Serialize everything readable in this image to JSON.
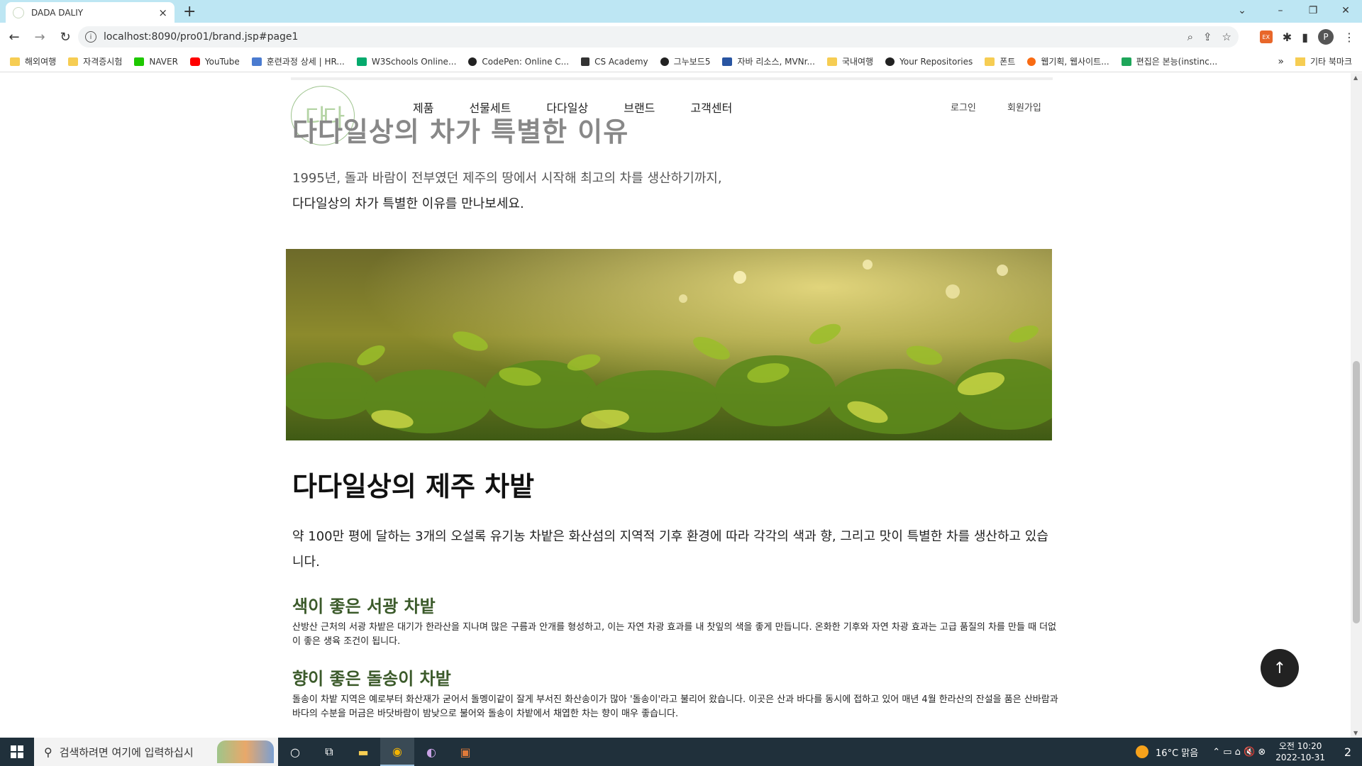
{
  "browser": {
    "tab_title": "DADA DALIY",
    "tab_close": "×",
    "new_tab": "+",
    "url": "localhost:8090/pro01/brand.jsp#page1",
    "window_controls": [
      "⌄",
      "–",
      "❐",
      "✕"
    ],
    "bookmarks": [
      {
        "label": "해외여행",
        "icon": "folder"
      },
      {
        "label": "자격증시험",
        "icon": "folder"
      },
      {
        "label": "NAVER",
        "icon": "naver"
      },
      {
        "label": "YouTube",
        "icon": "yt"
      },
      {
        "label": "훈련과정 상세 | HR...",
        "icon": "hrd"
      },
      {
        "label": "W3Schools Online...",
        "icon": "w3"
      },
      {
        "label": "CodePen: Online C...",
        "icon": "cp"
      },
      {
        "label": "CS Academy",
        "icon": "cs"
      },
      {
        "label": "그누보드5",
        "icon": "gb"
      },
      {
        "label": "자바 리소스, MVNr...",
        "icon": "mvn"
      },
      {
        "label": "국내여행",
        "icon": "folder"
      },
      {
        "label": "Your Repositories",
        "icon": "gh"
      },
      {
        "label": "폰트",
        "icon": "folder"
      },
      {
        "label": "웹기획, 웹사이트...",
        "icon": "wk"
      },
      {
        "label": "편집은 본능(instinc...",
        "icon": "bn"
      }
    ],
    "bookmarks_more": "»",
    "other_bookmarks": "기타 북마크",
    "profile_initial": "P"
  },
  "site": {
    "logo_text": "다다",
    "nav": [
      "제품",
      "선물세트",
      "다다일상",
      "브랜드",
      "고객센터"
    ],
    "login": "로그인",
    "signup": "회원가입",
    "section_title": "다다일상의 차가 특별한 이유",
    "intro_line1": "1995년, 돌과 바람이 전부였던 제주의 땅에서 시작해 최고의 차를 생산하기까지,",
    "intro_line2": "다다일상의 차가 특별한 이유를 만나보세요.",
    "farm_title": "다다일상의 제주 차밭",
    "farm_desc": "약 100만 평에 달하는 3개의 오설록 유기농 차밭은 화산섬의 지역적 기후 환경에 따라 각각의 색과 향, 그리고 맛이 특별한 차를 생산하고 있습니다.",
    "farm1_title": "색이 좋은 서광 차밭",
    "farm1_desc": "산방산 근처의 서광 차밭은 대기가 한라산을 지나며 많은 구름과 안개를 형성하고, 이는 자연 차광 효과를 내 찻잎의 색을 좋게 만듭니다. 온화한 기후와 자연 차광 효과는 고급 품질의 차를 만들 때 더없이 좋은 생육 조건이 됩니다.",
    "farm2_title": "향이 좋은 돌송이 차밭",
    "farm2_desc": "돌송이 차밭 지역은 예로부터 화산재가 굳어서 돌멩이같이 잘게 부서진 화산송이가 많아 '돌송이'라고 불리어 왔습니다. 이곳은 산과 바다를 동시에 접하고 있어 매년 4월 한라산의 잔설을 품은 산바람과 바다의 수분을 머금은 바닷바람이 밤낮으로 불어와 돌송이 차밭에서 채엽한 차는 향이 매우 좋습니다.",
    "to_top": "↑"
  },
  "taskbar": {
    "search_placeholder": "검색하려면 여기에 입력하십시",
    "weather": "16°C  맑음",
    "time": "오전 10:20",
    "date": "2022-10-31",
    "notifications": "2"
  }
}
